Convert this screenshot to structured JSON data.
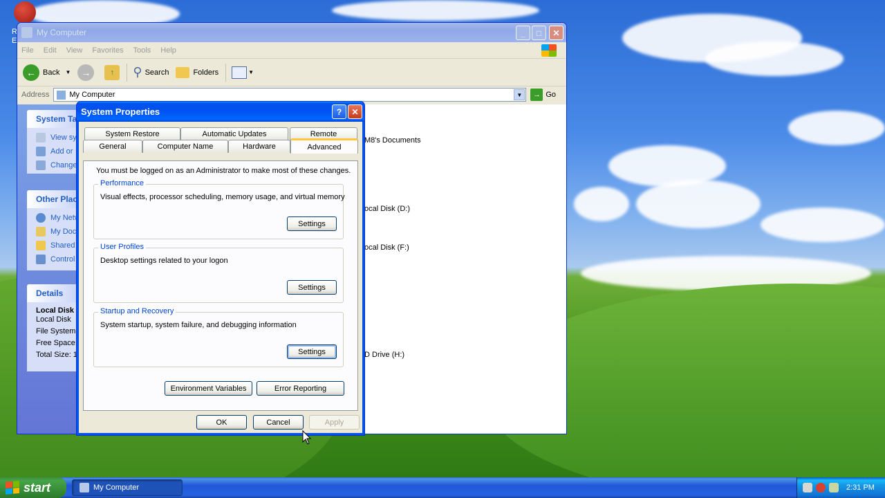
{
  "explorer": {
    "title": "My Computer",
    "menu": [
      "File",
      "Edit",
      "View",
      "Favorites",
      "Tools",
      "Help"
    ],
    "toolbar": {
      "back": "Back",
      "search": "Search",
      "folders": "Folders"
    },
    "address_label": "Address",
    "address_value": "My Computer",
    "go_label": "Go",
    "system_tasks": {
      "title": "System Ta",
      "items": [
        "View sy",
        "Add or",
        "Change"
      ]
    },
    "other_places": {
      "title": "Other Plac",
      "items": [
        "My Netw",
        "My Doc",
        "Shared",
        "Control"
      ]
    },
    "details": {
      "title": "Details",
      "name": "Local Disk",
      "type": "Local Disk",
      "file_system": "File System:",
      "free_space": "Free Space:",
      "total_size": "Total Size: 1"
    },
    "content_labels": [
      "M8's Documents",
      "ocal Disk (D:)",
      "ocal Disk (F:)",
      "D Drive (H:)"
    ]
  },
  "dialog": {
    "title": "System Properties",
    "tabs_back": [
      "System Restore",
      "Automatic Updates",
      "Remote"
    ],
    "tabs_front": [
      "General",
      "Computer Name",
      "Hardware",
      "Advanced"
    ],
    "notice": "You must be logged on as an Administrator to make most of these changes.",
    "groups": [
      {
        "title": "Performance",
        "desc": "Visual effects, processor scheduling, memory usage, and virtual memory",
        "button": "Settings"
      },
      {
        "title": "User Profiles",
        "desc": "Desktop settings related to your logon",
        "button": "Settings"
      },
      {
        "title": "Startup and Recovery",
        "desc": "System startup, system failure, and debugging information",
        "button": "Settings"
      }
    ],
    "env_button": "Environment Variables",
    "error_button": "Error Reporting",
    "ok": "OK",
    "cancel": "Cancel",
    "apply": "Apply"
  },
  "taskbar": {
    "start": "start",
    "task": "My Computer",
    "clock": "2:31 PM"
  },
  "desktop_labels": [
    "R",
    "E"
  ]
}
